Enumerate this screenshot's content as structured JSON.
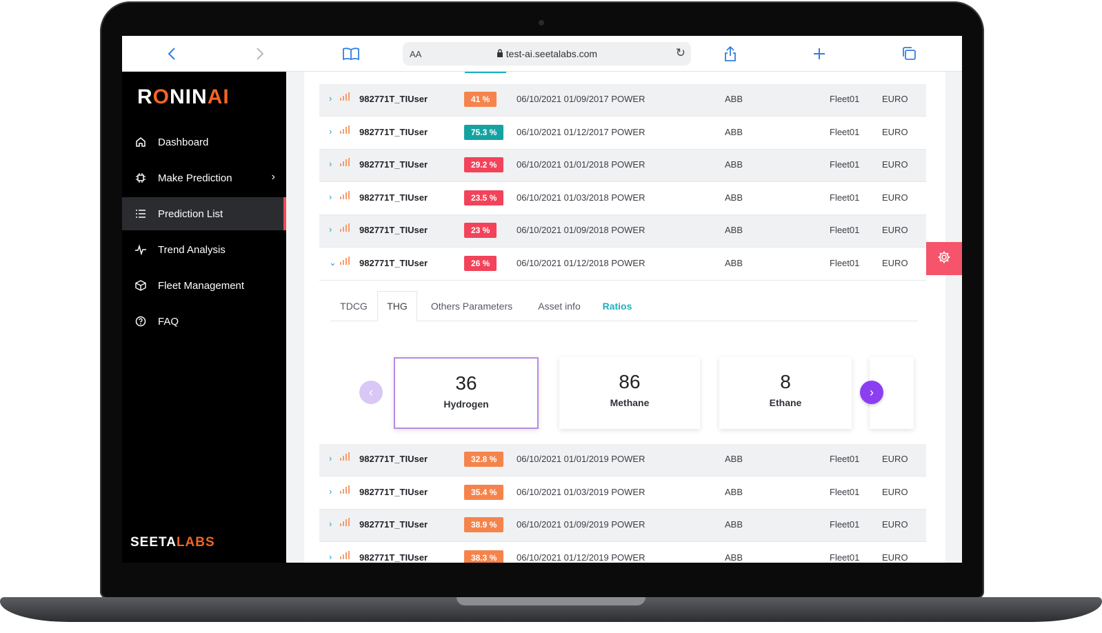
{
  "browser": {
    "url_prefix": "AA",
    "url": "test-ai.seetalabs.com",
    "icons": [
      "back-icon",
      "forward-icon",
      "bookmarks-icon",
      "lock-icon",
      "reload-icon",
      "share-icon",
      "new-tab-icon",
      "tabs-icon"
    ]
  },
  "sidebar": {
    "logo_part1": "R",
    "logo_part2": "O",
    "logo_part3": "NIN",
    "logo_part4": "AI",
    "items": [
      {
        "label": "Dashboard",
        "icon": "home-icon"
      },
      {
        "label": "Make Prediction",
        "icon": "chip-icon"
      },
      {
        "label": "Prediction List",
        "icon": "list-icon"
      },
      {
        "label": "Trend Analysis",
        "icon": "pulse-icon"
      },
      {
        "label": "Fleet Management",
        "icon": "box-icon"
      },
      {
        "label": "FAQ",
        "icon": "help-circle-icon"
      }
    ],
    "footer_logo_part1": "SEETA",
    "footer_logo_part2": "LABS"
  },
  "rows_top": [
    {
      "user": "982771T_TIUser",
      "percent": "41 %",
      "color": "#f5844c",
      "date": "06/10/2021 01/09/2017",
      "type": "POWER",
      "manufacturer": "ABB",
      "fleet": "Fleet01",
      "currency": "EURO"
    },
    {
      "user": "982771T_TIUser",
      "percent": "75.3 %",
      "color": "#17a2a2",
      "date": "06/10/2021 01/12/2017",
      "type": "POWER",
      "manufacturer": "ABB",
      "fleet": "Fleet01",
      "currency": "EURO"
    },
    {
      "user": "982771T_TIUser",
      "percent": "29.2 %",
      "color": "#f2435a",
      "date": "06/10/2021 01/01/2018",
      "type": "POWER",
      "manufacturer": "ABB",
      "fleet": "Fleet01",
      "currency": "EURO"
    },
    {
      "user": "982771T_TIUser",
      "percent": "23.5 %",
      "color": "#f2435a",
      "date": "06/10/2021 01/03/2018",
      "type": "POWER",
      "manufacturer": "ABB",
      "fleet": "Fleet01",
      "currency": "EURO"
    },
    {
      "user": "982771T_TIUser",
      "percent": "23 %",
      "color": "#f2435a",
      "date": "06/10/2021 01/09/2018",
      "type": "POWER",
      "manufacturer": "ABB",
      "fleet": "Fleet01",
      "currency": "EURO"
    },
    {
      "user": "982771T_TIUser",
      "percent": "26 %",
      "color": "#f2435a",
      "date": "06/10/2021 01/12/2018",
      "type": "POWER",
      "manufacturer": "ABB",
      "fleet": "Fleet01",
      "currency": "EURO"
    }
  ],
  "tabs": [
    "TDCG",
    "THG",
    "Others Parameters",
    "Asset info",
    "Ratios"
  ],
  "cards": [
    {
      "value": "36",
      "label": "Hydrogen"
    },
    {
      "value": "86",
      "label": "Methane"
    },
    {
      "value": "8",
      "label": "Ethane"
    }
  ],
  "rows_bottom": [
    {
      "user": "982771T_TIUser",
      "percent": "32.8 %",
      "color": "#f5844c",
      "date": "06/10/2021 01/01/2019",
      "type": "POWER",
      "manufacturer": "ABB",
      "fleet": "Fleet01",
      "currency": "EURO"
    },
    {
      "user": "982771T_TIUser",
      "percent": "35.4 %",
      "color": "#f5844c",
      "date": "06/10/2021 01/03/2019",
      "type": "POWER",
      "manufacturer": "ABB",
      "fleet": "Fleet01",
      "currency": "EURO"
    },
    {
      "user": "982771T_TIUser",
      "percent": "38.9 %",
      "color": "#f5844c",
      "date": "06/10/2021 01/09/2019",
      "type": "POWER",
      "manufacturer": "ABB",
      "fleet": "Fleet01",
      "currency": "EURO"
    },
    {
      "user": "982771T_TIUser",
      "percent": "38.3 %",
      "color": "#f5844c",
      "date": "06/10/2021 01/12/2019",
      "type": "POWER",
      "manufacturer": "ABB",
      "fleet": "Fleet01",
      "currency": "EURO"
    }
  ]
}
